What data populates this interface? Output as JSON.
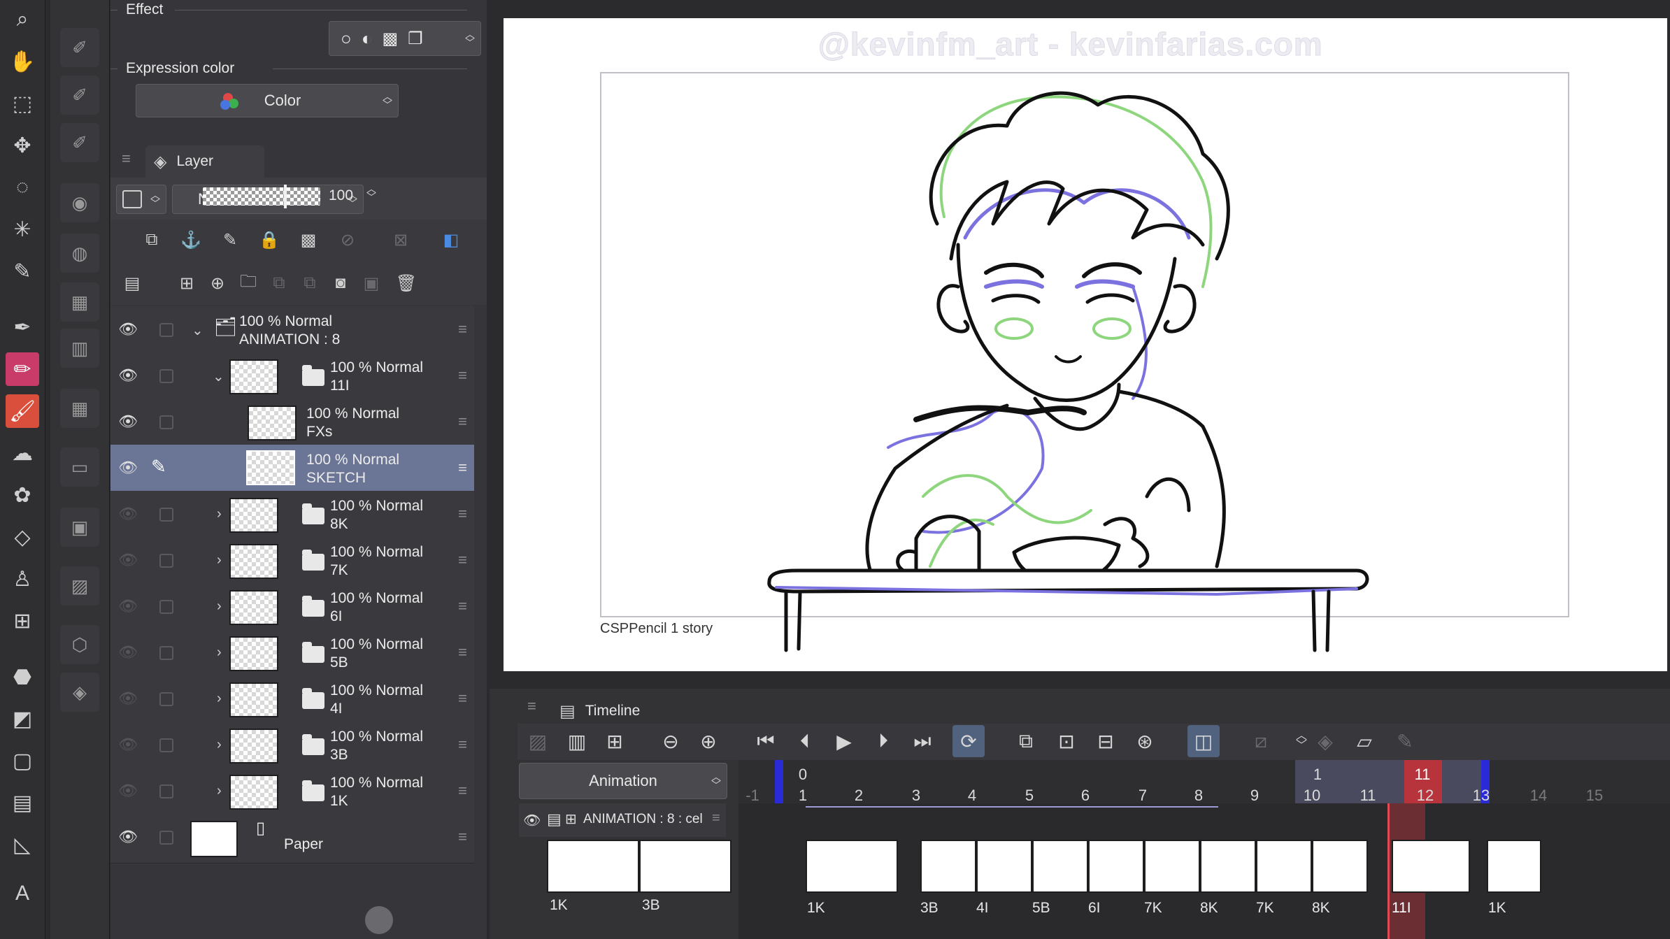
{
  "properties": {
    "effect_label": "Effect",
    "expression_color_label": "Expression color",
    "expression_color_value": "Color"
  },
  "layer_panel": {
    "tab_label": "Layer",
    "blend_mode": "Normal",
    "opacity": "100",
    "layers": [
      {
        "line1": "100 % Normal",
        "line2": "ANIMATION : 8"
      },
      {
        "line1": "100 % Normal",
        "line2": "11I"
      },
      {
        "line1": "100 % Normal",
        "line2": "FXs"
      },
      {
        "line1": "100 % Normal",
        "line2": "SKETCH"
      },
      {
        "line1": "100 % Normal",
        "line2": "8K"
      },
      {
        "line1": "100 % Normal",
        "line2": "7K"
      },
      {
        "line1": "100 % Normal",
        "line2": "6I"
      },
      {
        "line1": "100 % Normal",
        "line2": "5B"
      },
      {
        "line1": "100 % Normal",
        "line2": "4I"
      },
      {
        "line1": "100 % Normal",
        "line2": "3B"
      },
      {
        "line1": "100 % Normal",
        "line2": "1K"
      },
      {
        "line1": "Paper",
        "line2": ""
      }
    ]
  },
  "canvas": {
    "watermark": "@kevinfm_art - kevinfarias.com",
    "caption": "CSPPencil 1 story"
  },
  "timeline": {
    "tab_label": "Timeline",
    "track_selector": "Animation",
    "track_name": "ANIMATION : 8 : cel",
    "ruler_top": [
      "0",
      "1",
      "11"
    ],
    "ruler_numbers": [
      "-1",
      "1",
      "2",
      "3",
      "4",
      "5",
      "6",
      "7",
      "8",
      "9",
      "10",
      "11",
      "12",
      "13",
      "14",
      "15"
    ],
    "left_cels": [
      "1K",
      "3B"
    ],
    "cels": [
      "1K",
      "3B",
      "4I",
      "5B",
      "6I",
      "7K",
      "8K",
      "7K",
      "8K",
      "11I",
      "1K"
    ]
  },
  "colors": {
    "selected_layer": "#6b7596",
    "current_frame": "#b8343c",
    "active_tool": "#c93c6a"
  }
}
